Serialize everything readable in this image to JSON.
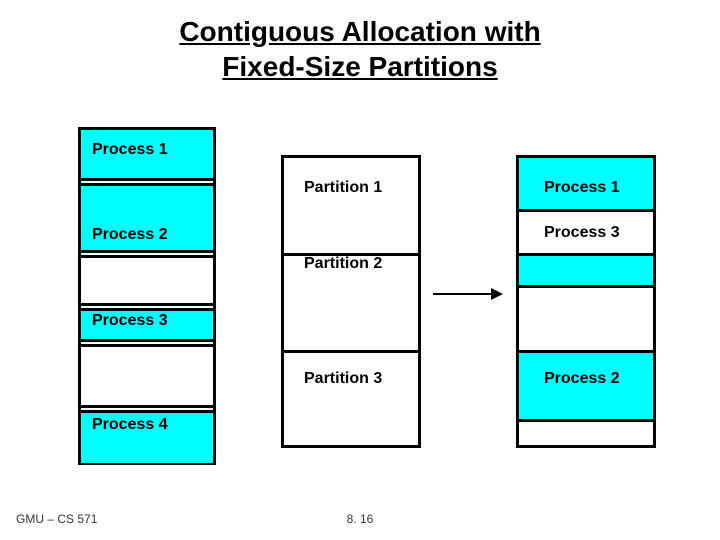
{
  "title_line1": "Contiguous Allocation with",
  "title_line2": "Fixed-Size Partitions",
  "left": {
    "p1": "Process 1",
    "p2": "Process 2",
    "p3": "Process 3",
    "p4": "Process 4"
  },
  "mid": {
    "part1": "Partition 1",
    "part2": "Partition 2",
    "part3": "Partition 3"
  },
  "right": {
    "p1": "Process 1",
    "p3": "Process 3",
    "p2": "Process 2"
  },
  "footer_left": "GMU – CS 571",
  "footer_center": "8. 16"
}
